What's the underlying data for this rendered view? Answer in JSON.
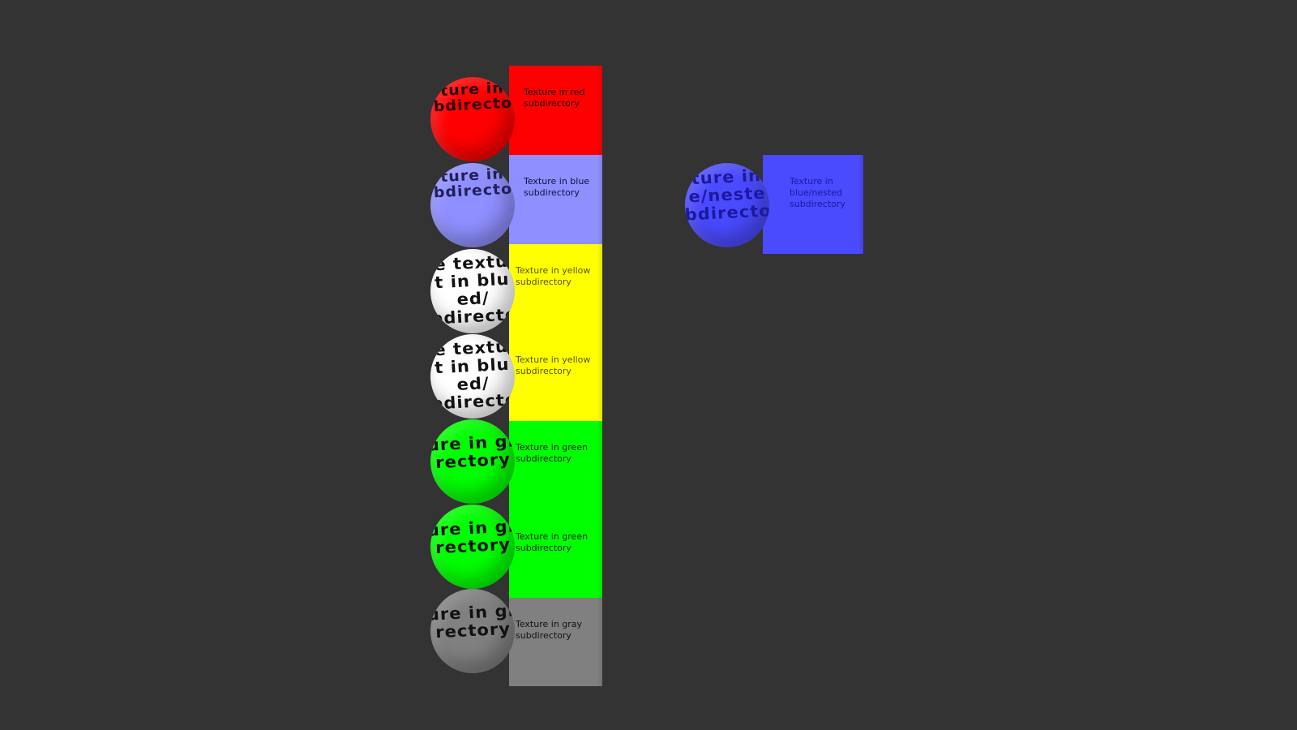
{
  "background_color": "#333333",
  "objects": [
    {
      "id": "red",
      "sphere_text": "ture in\nbdirecto",
      "label": "Texture in red subdirectory",
      "color": "#ff0000",
      "text_color": "#1a0000"
    },
    {
      "id": "blue",
      "sphere_text": "ture in\nbdirecto",
      "label": "Texture in blue subdirectory",
      "color": "#8f8fff",
      "text_color": "#101040"
    },
    {
      "id": "yellow-1",
      "sphere_text": "e textu\nt in blu\ned/\nbdirecto",
      "label": "Texture in yellow subdirectory",
      "color": "#ffff00",
      "sphere_color": "#ffffff",
      "text_color": "#555500"
    },
    {
      "id": "yellow-2",
      "sphere_text": "e textu\nt in blu\ned/\nbdirecto",
      "label": "Texture in yellow subdirectory",
      "color": "#ffff00",
      "sphere_color": "#ffffff",
      "text_color": "#555500"
    },
    {
      "id": "green-1",
      "sphere_text": "ure in gr\nrectory",
      "label": "Texture in green subdirectory",
      "color": "#00ff00",
      "text_color": "#002200"
    },
    {
      "id": "green-2",
      "sphere_text": "ure in gr\nrectory",
      "label": "Texture in green subdirectory",
      "color": "#00ff00",
      "text_color": "#002200"
    },
    {
      "id": "gray",
      "sphere_text": "ure in gr\nrectory",
      "label": "Texture in gray subdirectory",
      "color": "#808080",
      "text_color": "#111111"
    }
  ],
  "nested": {
    "sphere_text": "ture in\ne/neste\nbdirecto",
    "label": "Texture in blue/nested subdirectory",
    "color": "#4a4aff",
    "text_color": "#1a1aa0"
  }
}
